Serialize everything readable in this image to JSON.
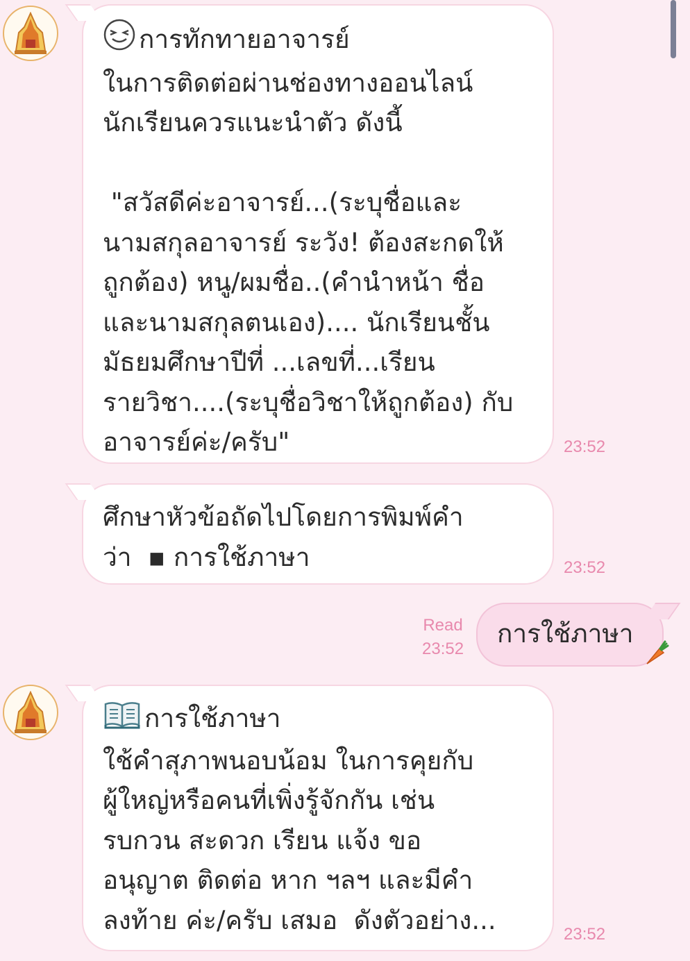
{
  "messages": [
    {
      "line1": "การทักทายอาจารย์",
      "rest": "ในการติดต่อผ่านช่องทางออนไลน์\nนักเรียนควรแนะนำตัว ดังนี้\n\n \"สวัสดีค่ะอาจารย์...(ระบุชื่อและ\nนามสกุลอาจารย์ ระวัง! ต้องสะกดให้\nถูกต้อง) หนู/ผมชื่อ..(คำนำหน้า ชื่อ\nและนามสกุลตนเอง).... นักเรียนชั้น\nมัธยมศึกษาปีที่ ...เลขที่...เรียน\nรายวิชา....(ระบุชื่อวิชาให้ถูกต้อง) กับ\nอาจารย์ค่ะ/ครับ\"",
      "time": "23:52",
      "icon": "grinning-face-icon"
    },
    {
      "text": "ศึกษาหัวข้อถัดไปโดยการพิมพ์คำ\nว่า  ▪ การใช้ภาษา",
      "time": "23:52"
    },
    {
      "text": "การใช้ภาษา",
      "read": "Read",
      "time": "23:52",
      "icon": "carrot-icon"
    },
    {
      "line1": "การใช้ภาษา",
      "rest": "ใช้คำสุภาพนอบน้อม ในการคุยกับ\nผู้ใหญ่หรือคนที่เพิ่งรู้จักกัน เช่น\nรบกวน สะดวก เรียน แจ้ง ขอ\nอนุญาต ติดต่อ หาก ฯลฯ และมีคำ\nลงท้าย ค่ะ/ครับ เสมอ  ดังตัวอย่าง...",
      "time": "23:52",
      "icon": "open-book-icon"
    }
  ],
  "colors": {
    "background": "#fcedf3",
    "bubble_in": "#ffffff",
    "bubble_out": "#fadcea",
    "timestamp": "#e889ad"
  }
}
